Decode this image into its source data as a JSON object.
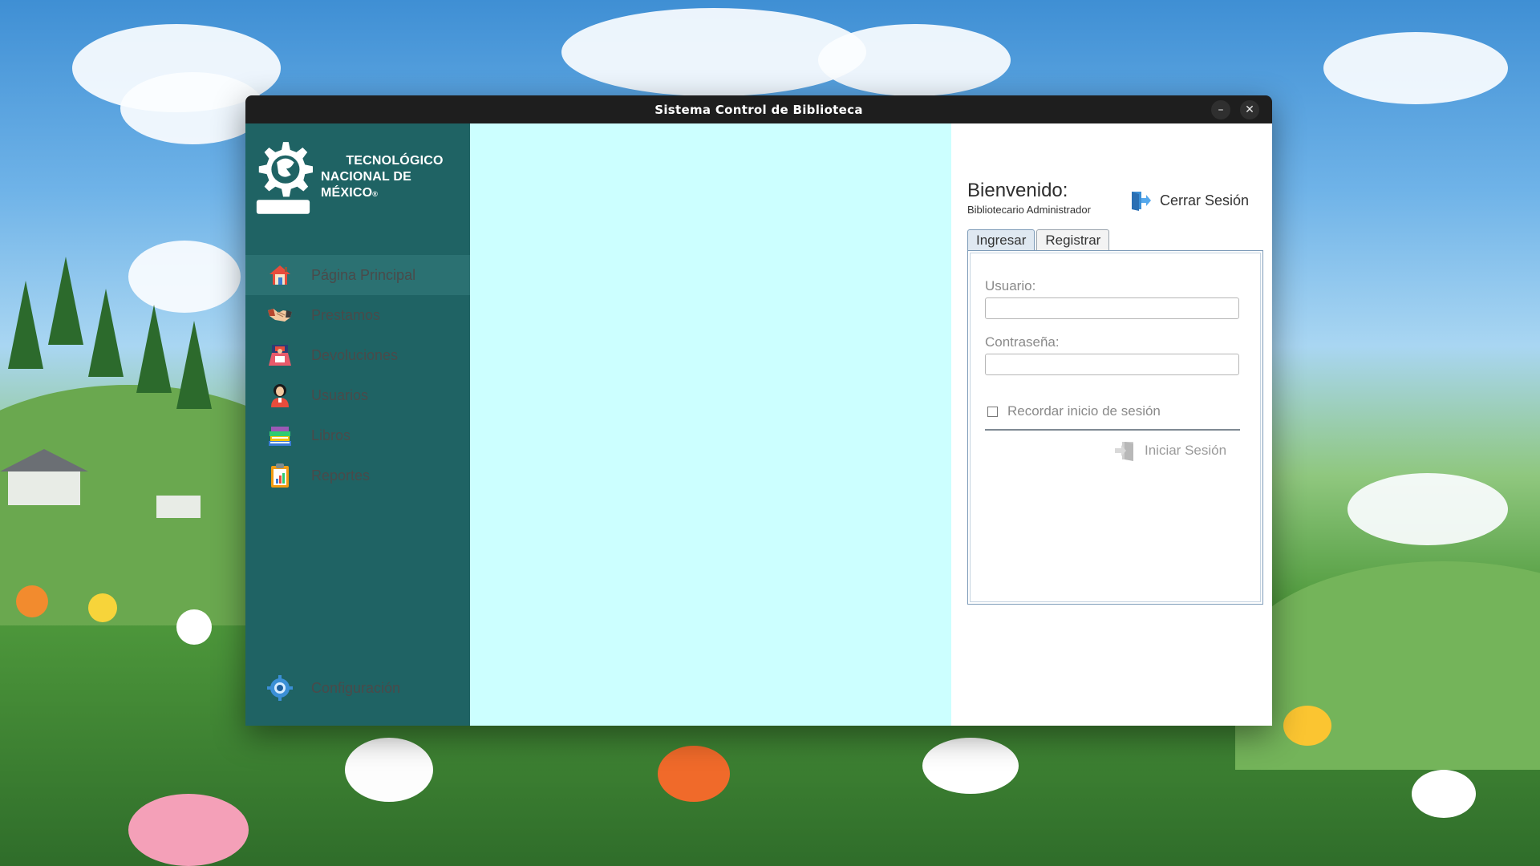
{
  "window": {
    "title": "Sistema Control de Biblioteca",
    "minimize_label": "–",
    "close_label": "✕"
  },
  "sidebar": {
    "logo": {
      "line1": "TECNOLÓGICO",
      "line2": "NACIONAL DE MÉXICO",
      "registered": "®"
    },
    "items": [
      {
        "label": "Página Principal",
        "icon": "home-icon",
        "active": true
      },
      {
        "label": "Prestamos",
        "icon": "handshake-icon",
        "active": false
      },
      {
        "label": "Devoluciones",
        "icon": "return-icon",
        "active": false
      },
      {
        "label": "Usuarios",
        "icon": "user-icon",
        "active": false
      },
      {
        "label": "Libros",
        "icon": "books-icon",
        "active": false
      },
      {
        "label": "Reportes",
        "icon": "clipboard-icon",
        "active": false
      }
    ],
    "config": {
      "label": "Configuración",
      "icon": "gear-icon"
    }
  },
  "header": {
    "welcome": "Bienvenido:",
    "role": "Bibliotecario Administrador",
    "logout_label": "Cerrar Sesión"
  },
  "tabs": [
    {
      "label": "Ingresar",
      "active": true
    },
    {
      "label": "Registrar",
      "active": false
    }
  ],
  "login": {
    "user_label": "Usuario:",
    "user_value": "",
    "password_label": "Contraseña:",
    "password_value": "",
    "remember_label": "Recordar inicio de sesión",
    "remember_checked": false,
    "submit_label": "Iniciar Sesión"
  },
  "colors": {
    "sidebar": "#1f6364",
    "sidebar_active": "#2b7172",
    "center": "#ccffff",
    "titlebar": "#1e1e1e"
  }
}
